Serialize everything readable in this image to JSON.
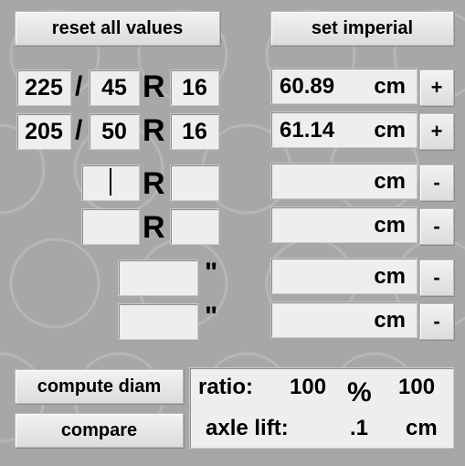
{
  "buttons": {
    "reset": "reset all values",
    "imperial": "set imperial",
    "compute": "compute diam",
    "compare": "compare"
  },
  "tires": [
    {
      "width": "225",
      "sep": "/",
      "aspect": "45",
      "r": "R",
      "rim": "16"
    },
    {
      "width": "205",
      "sep": "/",
      "aspect": "50",
      "r": "R",
      "rim": "16"
    },
    {
      "width": "",
      "r": "R",
      "rim": ""
    },
    {
      "width": "",
      "r": "R",
      "rim": ""
    }
  ],
  "inch_rows": [
    {
      "value": "",
      "unit": "\""
    },
    {
      "value": "",
      "unit": "\""
    }
  ],
  "diameters": [
    {
      "value": "60.89",
      "unit": "cm",
      "action": "+"
    },
    {
      "value": "61.14",
      "unit": "cm",
      "action": "+"
    },
    {
      "value": "",
      "unit": "cm",
      "action": "-"
    },
    {
      "value": "",
      "unit": "cm",
      "action": "-"
    },
    {
      "value": "",
      "unit": "cm",
      "action": "-"
    },
    {
      "value": "",
      "unit": "cm",
      "action": "-"
    }
  ],
  "result": {
    "ratio_label": "ratio:",
    "ratio_a": "100",
    "percent": "%",
    "ratio_b": "100",
    "axle_label": "axle lift:",
    "axle_value": ".1",
    "axle_unit": "cm"
  },
  "colors": {
    "background": "#a7a7a7",
    "field": "#eeeeee",
    "button": "#e8e8e8"
  }
}
